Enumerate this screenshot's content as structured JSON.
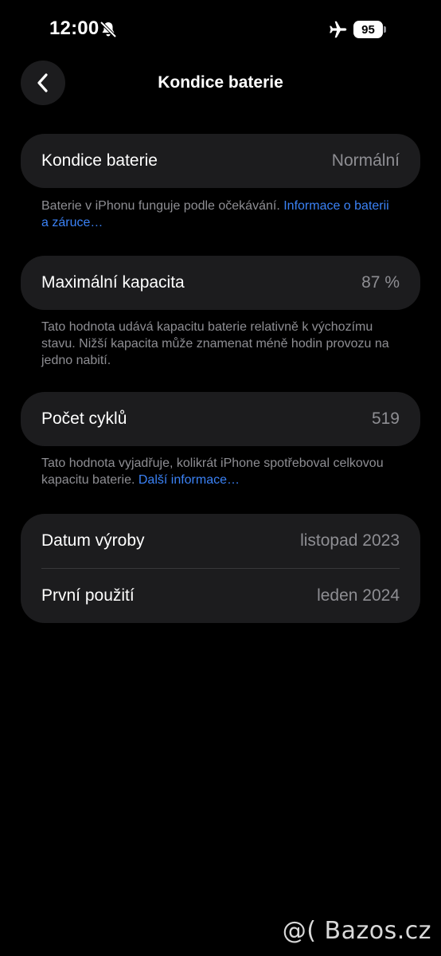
{
  "status_bar": {
    "time": "12:00",
    "battery_level": "95",
    "icons": [
      "bell-slash-icon",
      "airplane-icon",
      "battery-icon"
    ]
  },
  "nav": {
    "title": "Kondice baterie",
    "back_icon": "chevron-left-icon"
  },
  "sections": {
    "health": {
      "label": "Kondice baterie",
      "value": "Normální",
      "note_text": "Baterie v iPhonu funguje podle očekávání. ",
      "note_link": "Informace o baterii a záruce…"
    },
    "capacity": {
      "label": "Maximální kapacita",
      "value": "87 %",
      "note_text": "Tato hodnota udává kapacitu baterie relativně k výchozímu stavu. Nižší kapacita může znamenat méně hodin provozu na jedno nabití."
    },
    "cycles": {
      "label": "Počet cyklů",
      "value": "519",
      "note_text": "Tato hodnota vyjadřuje, kolikrát iPhone spotřeboval celkovou kapacitu baterie. ",
      "note_link": "Další informace…"
    },
    "dates": {
      "manufacture_label": "Datum výroby",
      "manufacture_value": "listopad 2023",
      "first_use_label": "První použití",
      "first_use_value": "leden 2024"
    }
  },
  "watermark": "@( Bazos.cz",
  "colors": {
    "background": "#000000",
    "card": "#1c1c1e",
    "secondary_text": "#8e8e93",
    "link": "#3b82f6",
    "divider": "#38383a"
  }
}
